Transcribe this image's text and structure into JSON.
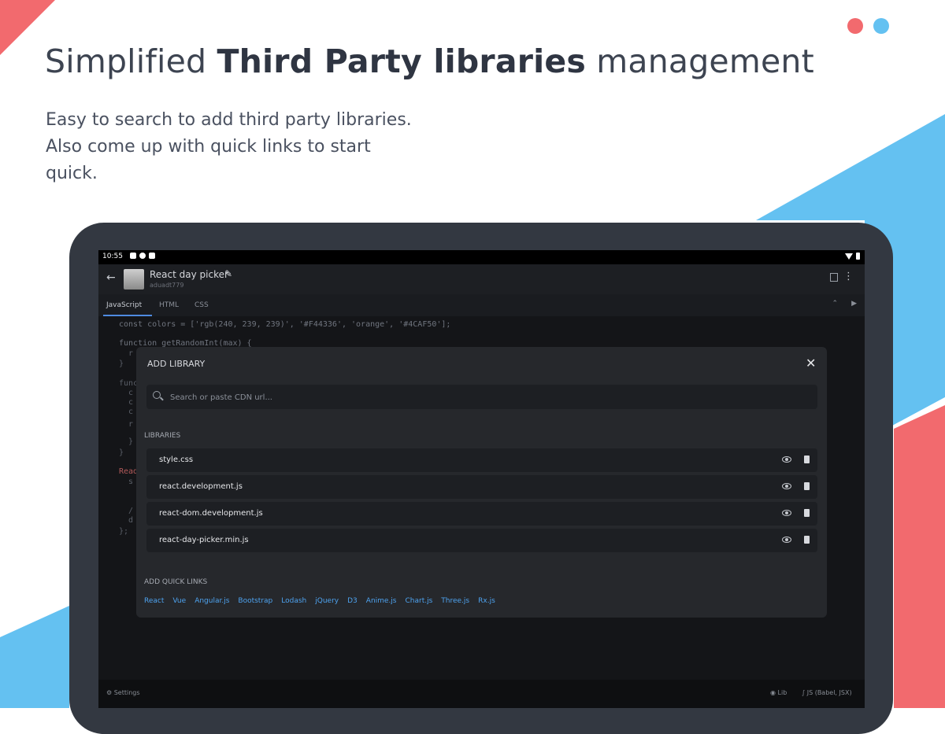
{
  "colors": {
    "accent_red": "#f26a6e",
    "accent_blue": "#64c1f1",
    "link_blue": "#4ea3f0"
  },
  "headline": {
    "pre": "Simplified ",
    "bold": "Third Party libraries",
    "post": " management"
  },
  "subtitle": "Easy to search to add third party libraries. Also come up with quick links to start quick.",
  "device": {
    "status": {
      "time": "10:55",
      "icons": [
        "notification-icon",
        "app-icon",
        "clipboard-icon"
      ],
      "right_icons": [
        "wifi-icon",
        "battery-icon"
      ]
    },
    "app_bar": {
      "title": "React day picker",
      "user": "aduadt779"
    },
    "tabs": [
      "JavaScript",
      "HTML",
      "CSS"
    ],
    "code": {
      "line1": "const colors = ['rgb(240, 239, 239)', '#F44336', 'orange', '#4CAF50'];",
      "line2": "function getRandomInt(max) {",
      "fragments": [
        "r",
        "}",
        "func",
        "c",
        "c",
        "c",
        "r",
        "}",
        "}",
        "Read",
        "s",
        "/",
        "d",
        "};"
      ]
    },
    "bottom": {
      "settings": "Settings",
      "lib": "Lib",
      "engine": "JS (Babel, JSX)"
    }
  },
  "dialog": {
    "title": "ADD LIBRARY",
    "search_placeholder": "Search or paste CDN url...",
    "libraries_label": "LIBRARIES",
    "libraries": [
      "style.css",
      "react.development.js",
      "react-dom.development.js",
      "react-day-picker.min.js"
    ],
    "quick_links_label": "ADD QUICK LINKS",
    "quick_links": [
      "React",
      "Vue",
      "Angular.js",
      "Bootstrap",
      "Lodash",
      "jQuery",
      "D3",
      "Anime.js",
      "Chart.js",
      "Three.js",
      "Rx.js"
    ]
  }
}
